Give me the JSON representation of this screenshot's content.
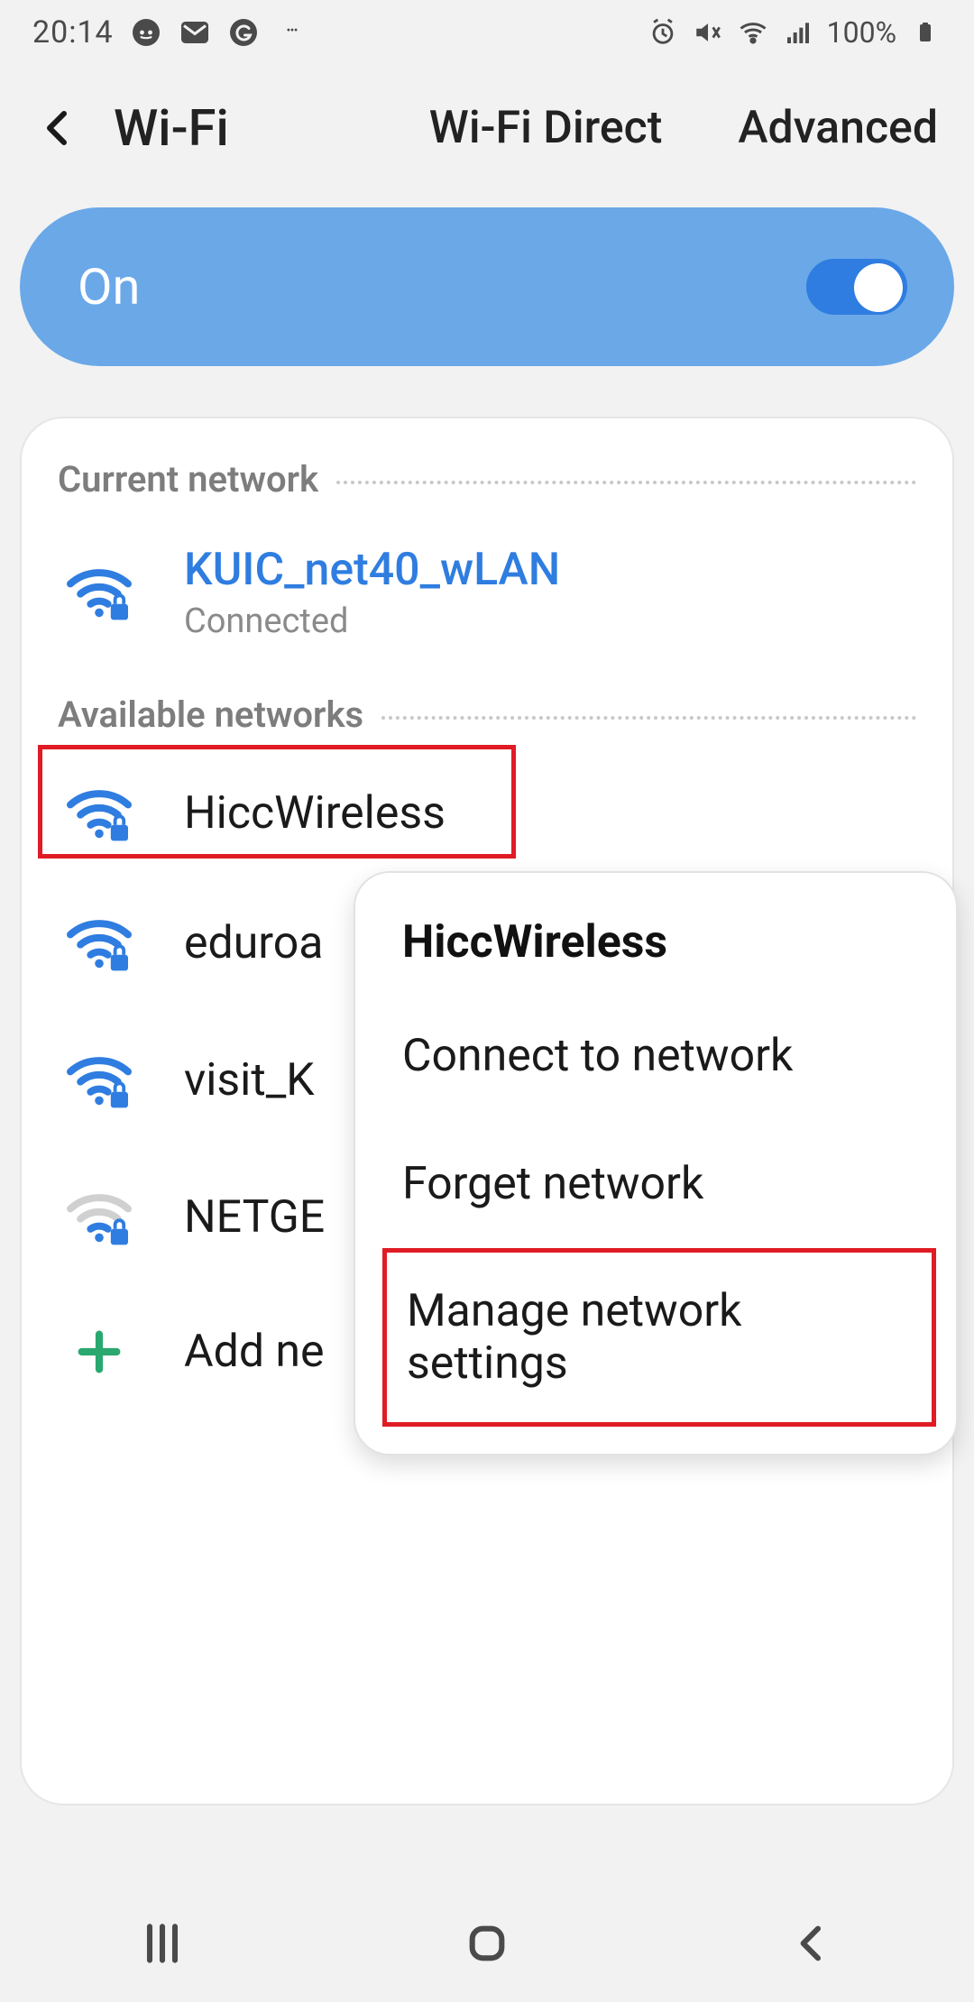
{
  "status": {
    "time": "20:14",
    "battery_text": "100%",
    "icons_left": [
      "reddit-icon",
      "mail-icon",
      "grammarly-icon",
      "more-icon"
    ],
    "icons_right": [
      "alarm-icon",
      "mute-icon",
      "wifi-icon",
      "signal-icon"
    ]
  },
  "header": {
    "title": "Wi-Fi",
    "actions": [
      "Wi-Fi Direct",
      "Advanced"
    ]
  },
  "toggle": {
    "label": "On",
    "state": true
  },
  "sections": {
    "current_label": "Current network",
    "available_label": "Available networks"
  },
  "current_network": {
    "name": "KUIC_net40_wLAN",
    "status": "Connected",
    "secured": true,
    "signal": "strong"
  },
  "available_networks": [
    {
      "name": "HiccWireless",
      "secured": true,
      "signal": "strong"
    },
    {
      "name": "eduroam",
      "secured": true,
      "signal": "strong",
      "truncated": "eduroa"
    },
    {
      "name": "visit_KUIC",
      "secured": true,
      "signal": "strong",
      "truncated": "visit_K"
    },
    {
      "name": "NETGEAR",
      "secured": true,
      "signal": "weak",
      "truncated": "NETGE"
    }
  ],
  "add_network_label": "Add network",
  "add_network_truncated": "Add ne",
  "popup": {
    "title": "HiccWireless",
    "items": [
      "Connect to network",
      "Forget network",
      "Manage network settings"
    ]
  },
  "colors": {
    "accent": "#2f7de0",
    "pill": "#6aa8e8",
    "highlight": "#e01b24",
    "plus": "#2aa86f"
  }
}
